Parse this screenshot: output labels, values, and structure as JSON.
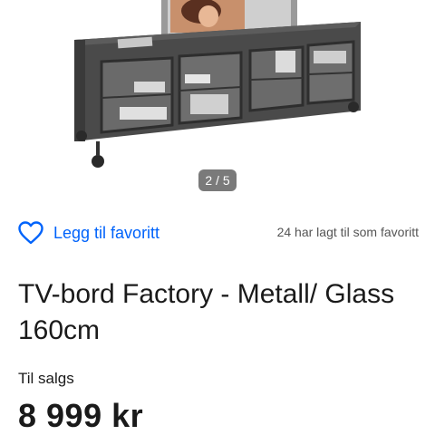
{
  "gallery": {
    "counter": "2 / 5"
  },
  "favorite": {
    "label": "Legg til favoritt",
    "count_text": "24 har lagt til som favoritt",
    "accent_color": "#0063fb"
  },
  "listing": {
    "title": "TV-bord Factory - Metall/ Glass 160cm",
    "status": "Til salgs",
    "price": "8 999 kr"
  },
  "icons": [
    "heart-outline-icon"
  ]
}
